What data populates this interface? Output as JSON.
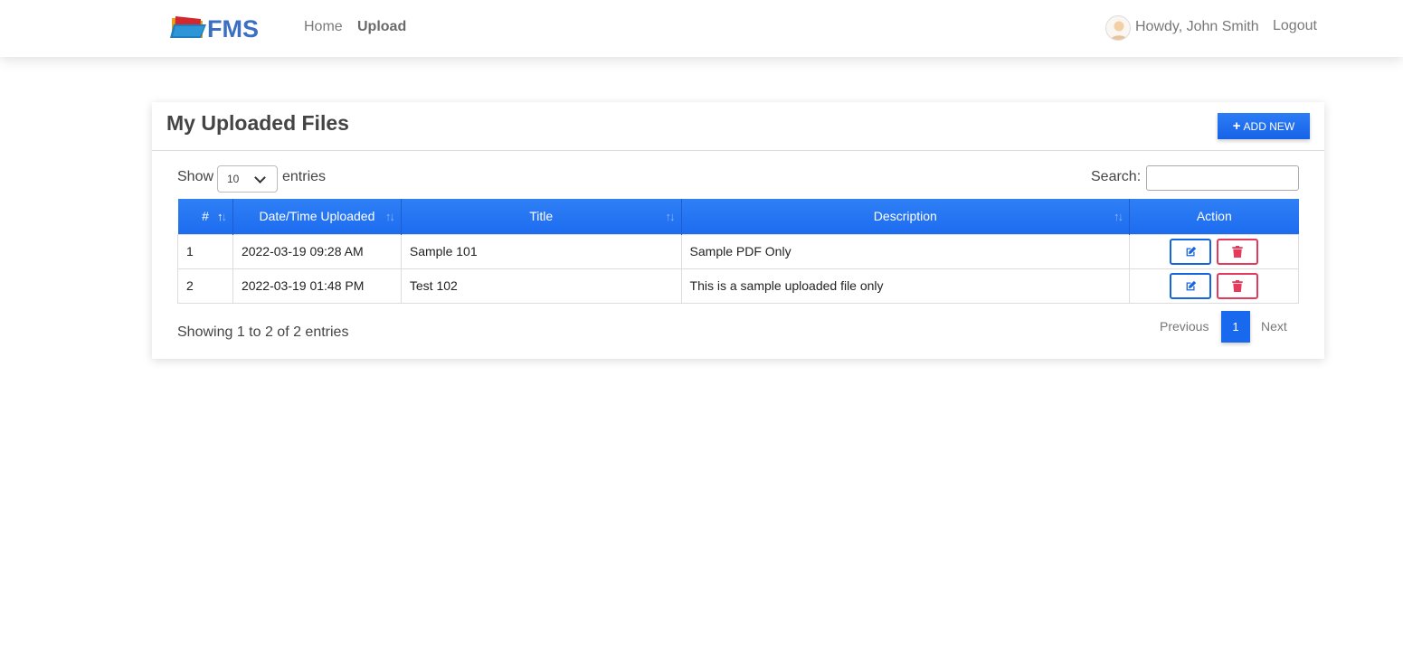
{
  "nav": {
    "logo_text": "FMS",
    "home": "Home",
    "upload": "Upload",
    "greeting": "Howdy, John Smith",
    "logout": "Logout"
  },
  "card": {
    "title": "My Uploaded Files",
    "add_new": "ADD NEW"
  },
  "controls": {
    "show": "Show",
    "page_length": "10",
    "entries": "entries",
    "search_label": "Search:",
    "search_value": ""
  },
  "table": {
    "headers": [
      "#",
      "Date/Time Uploaded",
      "Title",
      "Description",
      "Action"
    ],
    "rows": [
      {
        "num": "1",
        "datetime": "2022-03-19 09:28 AM",
        "title": "Sample 101",
        "description": "Sample PDF Only"
      },
      {
        "num": "2",
        "datetime": "2022-03-19 01:48 PM",
        "title": "Test 102",
        "description": "This is a sample uploaded file only"
      }
    ]
  },
  "footer": {
    "info": "Showing 1 to 2 of 2 entries",
    "previous": "Previous",
    "page": "1",
    "next": "Next"
  },
  "colors": {
    "primary": "#1d6cf0",
    "danger": "#e33a5b"
  },
  "icons": [
    "folder-logo-icon",
    "avatar-icon",
    "plus-icon",
    "chevron-down-icon",
    "sort-icon",
    "edit-icon",
    "trash-icon"
  ]
}
